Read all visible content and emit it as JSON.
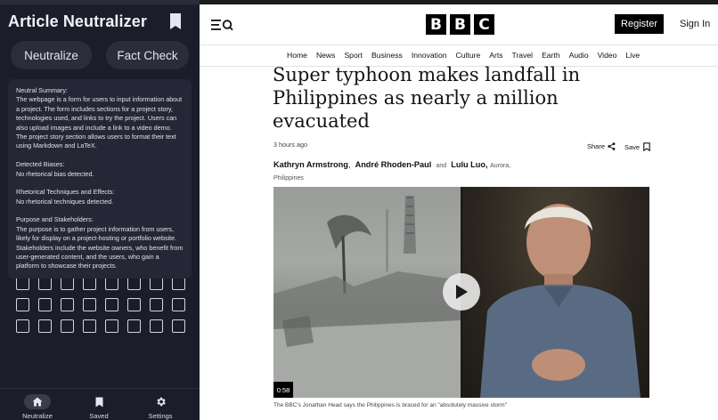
{
  "extension": {
    "title": "Article Neutralizer",
    "buttons": {
      "neutralize": "Neutralize",
      "fact_check": "Fact Check"
    },
    "summary": {
      "neutral_summary_heading": "Neutral Summary:",
      "neutral_summary_text": "The webpage is a form for users to input information about a project. The form includes sections for a project story, technologies used, and links to try the project. Users can also upload images and include a link to a video demo. The project story section allows users to format their text using Markdown and LaTeX.",
      "biases_heading": "Detected Biases:",
      "biases_text": "No rhetorical bias detected.",
      "techniques_heading": "Rhetorical Techniques and Effects:",
      "techniques_text": "No rhetorical techniques detected.",
      "purpose_heading": "Purpose and Stakeholders:",
      "purpose_text": "The purpose is to gather project information from users, likely for display on a project-hosting or portfolio website. Stakeholders include the website owners, who benefit from user-generated content, and the users, who gain a platform to showcase their projects."
    },
    "bottom_nav": {
      "neutralize": "Neutralize",
      "saved": "Saved",
      "settings": "Settings"
    }
  },
  "bbc": {
    "logo_letters": [
      "B",
      "B",
      "C"
    ],
    "register": "Register",
    "sign_in": "Sign In",
    "nav": [
      "Home",
      "News",
      "Sport",
      "Business",
      "Innovation",
      "Culture",
      "Arts",
      "Travel",
      "Earth",
      "Audio",
      "Video",
      "Live"
    ],
    "headline": "Super typhoon makes landfall in Philippines as nearly a million evacuated",
    "timestamp": "3 hours ago",
    "share": "Share",
    "save": "Save",
    "byline": {
      "author1": "Kathryn Armstrong",
      "sep1": ",",
      "author2": "André Rhoden-Paul",
      "and": "and",
      "author3": "Lulu Luo,",
      "location": "Aurora, Philippines"
    },
    "video_duration": "0:58",
    "caption": "The BBC's Jonathan Head says the Philippines is braced for an \"absolutely massive storm\""
  }
}
